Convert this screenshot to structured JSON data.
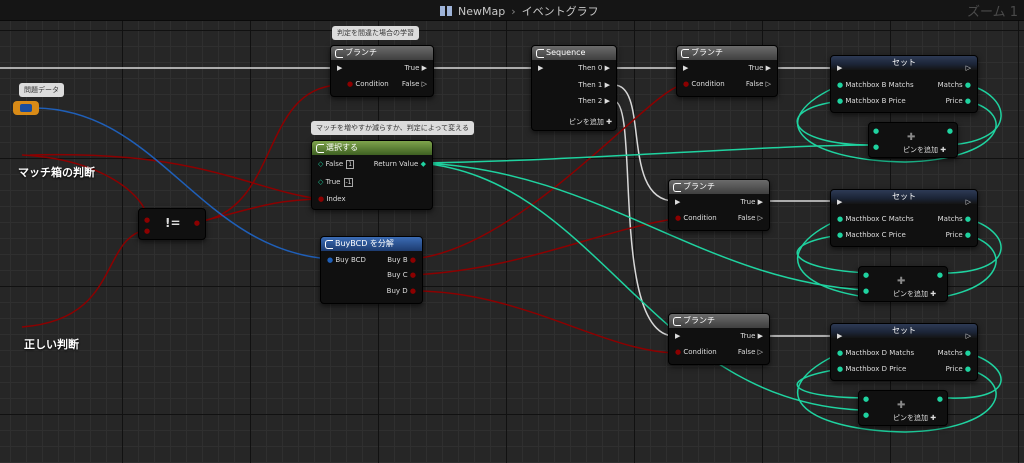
{
  "topbar": {
    "breadcrumb_map": "NewMap",
    "breadcrumb_graph": "イベントグラフ",
    "zoom": "ズーム 1"
  },
  "comments": {
    "branch_learn": "判定を間違た場合の学習",
    "select_note": "マッチを増やすか減らすか、判定によって変える",
    "problem_data": "問題データ"
  },
  "variables": {
    "matchbox_judge": "マッチ箱の判断",
    "correct_judge": "正しい判断"
  },
  "nodes": {
    "branch1": {
      "title": "ブランチ",
      "condition": "Condition",
      "true": "True",
      "false": "False"
    },
    "sequence": {
      "title": "Sequence",
      "then0": "Then 0",
      "then1": "Then 1",
      "then2": "Then 2",
      "add_pin": "ピンを追加"
    },
    "branch2": {
      "title": "ブランチ",
      "condition": "Condition",
      "true": "True",
      "false": "False"
    },
    "branch3": {
      "title": "ブランチ",
      "condition": "Condition",
      "true": "True",
      "false": "False"
    },
    "branch4": {
      "title": "ブランチ",
      "condition": "Condition",
      "true": "True",
      "false": "False"
    },
    "select": {
      "title": "選択する",
      "false": "False",
      "false_val": "1",
      "true": "True",
      "true_val": "-1",
      "index": "Index",
      "return": "Return Value"
    },
    "neq": {
      "symbol": "!="
    },
    "break": {
      "title": "BuyBCD を分解",
      "in": "Buy BCD",
      "b": "Buy B",
      "c": "Buy C",
      "d": "Buy D"
    },
    "setB": {
      "title": "セット",
      "in1": "Matchbox B Matchs",
      "in2": "Matchbox B Price",
      "out1": "Matchs",
      "out2": "Price"
    },
    "setC": {
      "title": "セット",
      "in1": "Macthbox C Matchs",
      "in2": "Macthbox C Price",
      "out1": "Matchs",
      "out2": "Price"
    },
    "setD": {
      "title": "セット",
      "in1": "Macthbox D Matchs",
      "in2": "Macthbox D Price",
      "out1": "Matchs",
      "out2": "Price"
    },
    "addB": {
      "label": "ピンを追加"
    },
    "addC": {
      "label": "ピンを追加"
    },
    "addD": {
      "label": "ピンを追加"
    }
  },
  "colors": {
    "exec": "#ffffff",
    "bool": "#8c0000",
    "int": "#1fd3a0",
    "struct": "#1f5fb8"
  }
}
